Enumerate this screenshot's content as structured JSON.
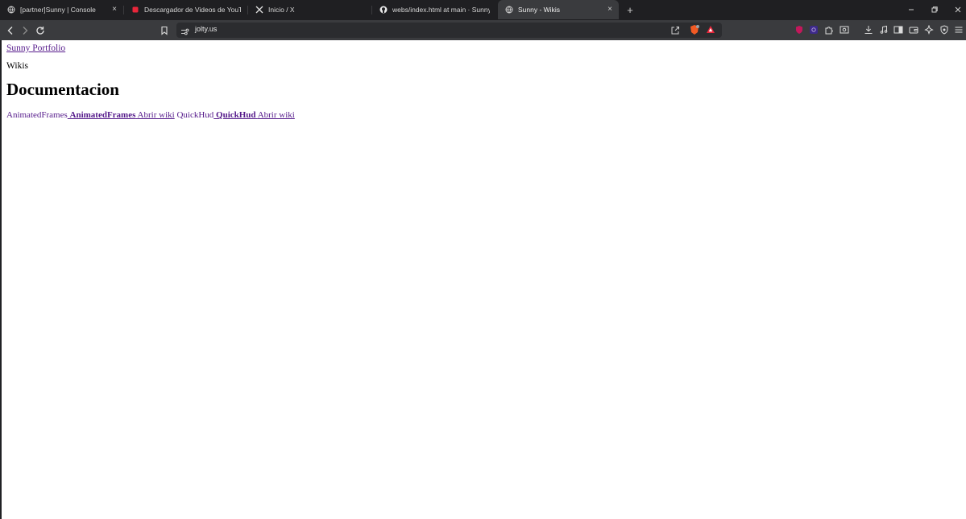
{
  "browser": {
    "tabs": [
      {
        "title": "[partner]Sunny | Console",
        "favicon": "globe-icon",
        "active": false
      },
      {
        "title": "Descargador de Videos de YouTube |",
        "favicon": "red-square-icon",
        "active": false
      },
      {
        "title": "Inicio / X",
        "favicon": "x-logo-icon",
        "active": false
      },
      {
        "title": "webs/index.html at main · SunnyMP/",
        "favicon": "github-icon",
        "active": false
      },
      {
        "title": "Sunny - Wikis",
        "favicon": "globe-icon",
        "active": true
      }
    ],
    "new_tab_symbol": "+",
    "close_symbol": "×",
    "address": {
      "url": "jolty.us"
    },
    "colors": {
      "frame": "#1f1f22",
      "toolbar": "#3a3b3e",
      "omnibox": "#2b2c2f",
      "link_visited": "#551a8b"
    }
  },
  "page": {
    "nav_link": " Sunny Portfolio",
    "subtitle": "Wikis",
    "heading": "Documentacion",
    "wikis": [
      {
        "img_alt": "AnimatedFrames",
        "name": "AnimatedFrames",
        "action": "Abrir wiki"
      },
      {
        "img_alt": "QuickHud",
        "name": "QuickHud",
        "action": "Abrir wiki"
      }
    ]
  }
}
